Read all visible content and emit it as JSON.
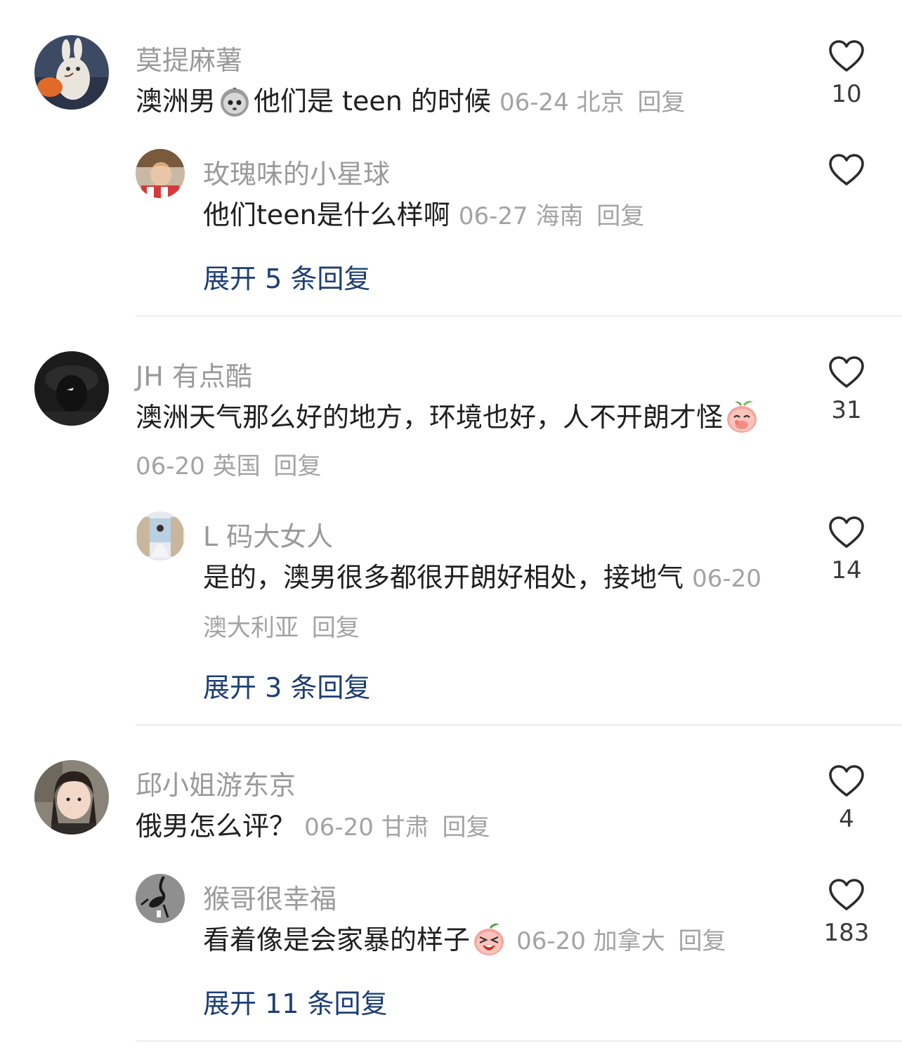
{
  "threads": [
    {
      "comment": {
        "username": "莫提麻薯",
        "text": "澳洲男",
        "emoji": "crying-ghost-emoji",
        "text_after": "他们是 teen 的时候",
        "date": "06-24",
        "location": "北京",
        "reply_label": "回复",
        "likes": "10"
      },
      "reply": {
        "username": "玫瑰味的小星球",
        "text": "他们teen是什么样啊",
        "date": "06-27",
        "location": "海南",
        "reply_label": "回复",
        "likes": ""
      },
      "expand_label": "展开 5 条回复"
    },
    {
      "comment": {
        "username": "JH 有点酷",
        "text": "澳洲天气那么好的地方，环境也好，人不开朗才怪",
        "emoji": "covering-mouth-peach-emoji",
        "date": "06-20",
        "location": "英国",
        "reply_label": "回复",
        "likes": "31"
      },
      "reply": {
        "username": "L 码大女人",
        "text": "是的，澳男很多都很开朗好相处，接地气",
        "date": "06-20",
        "location": "澳大利亚",
        "reply_label": "回复",
        "likes": "14"
      },
      "expand_label": "展开 3 条回复"
    },
    {
      "comment": {
        "username": "邱小姐游东京",
        "text": "俄男怎么评？",
        "date": "06-20",
        "location": "甘肃",
        "reply_label": "回复",
        "likes": "4"
      },
      "reply": {
        "username": "猴哥很幸福",
        "text": "看着像是会家暴的样子",
        "emoji": "crying-peach-emoji",
        "date": "06-20",
        "location": "加拿大",
        "reply_label": "回复",
        "likes": "183"
      },
      "expand_label": "展开 11 条回复"
    }
  ],
  "colors": {
    "username": "#9a9a9a",
    "body": "#1f1f1f",
    "meta": "#a3a3a3",
    "expand": "#1d3e74",
    "divider": "#ececec"
  }
}
